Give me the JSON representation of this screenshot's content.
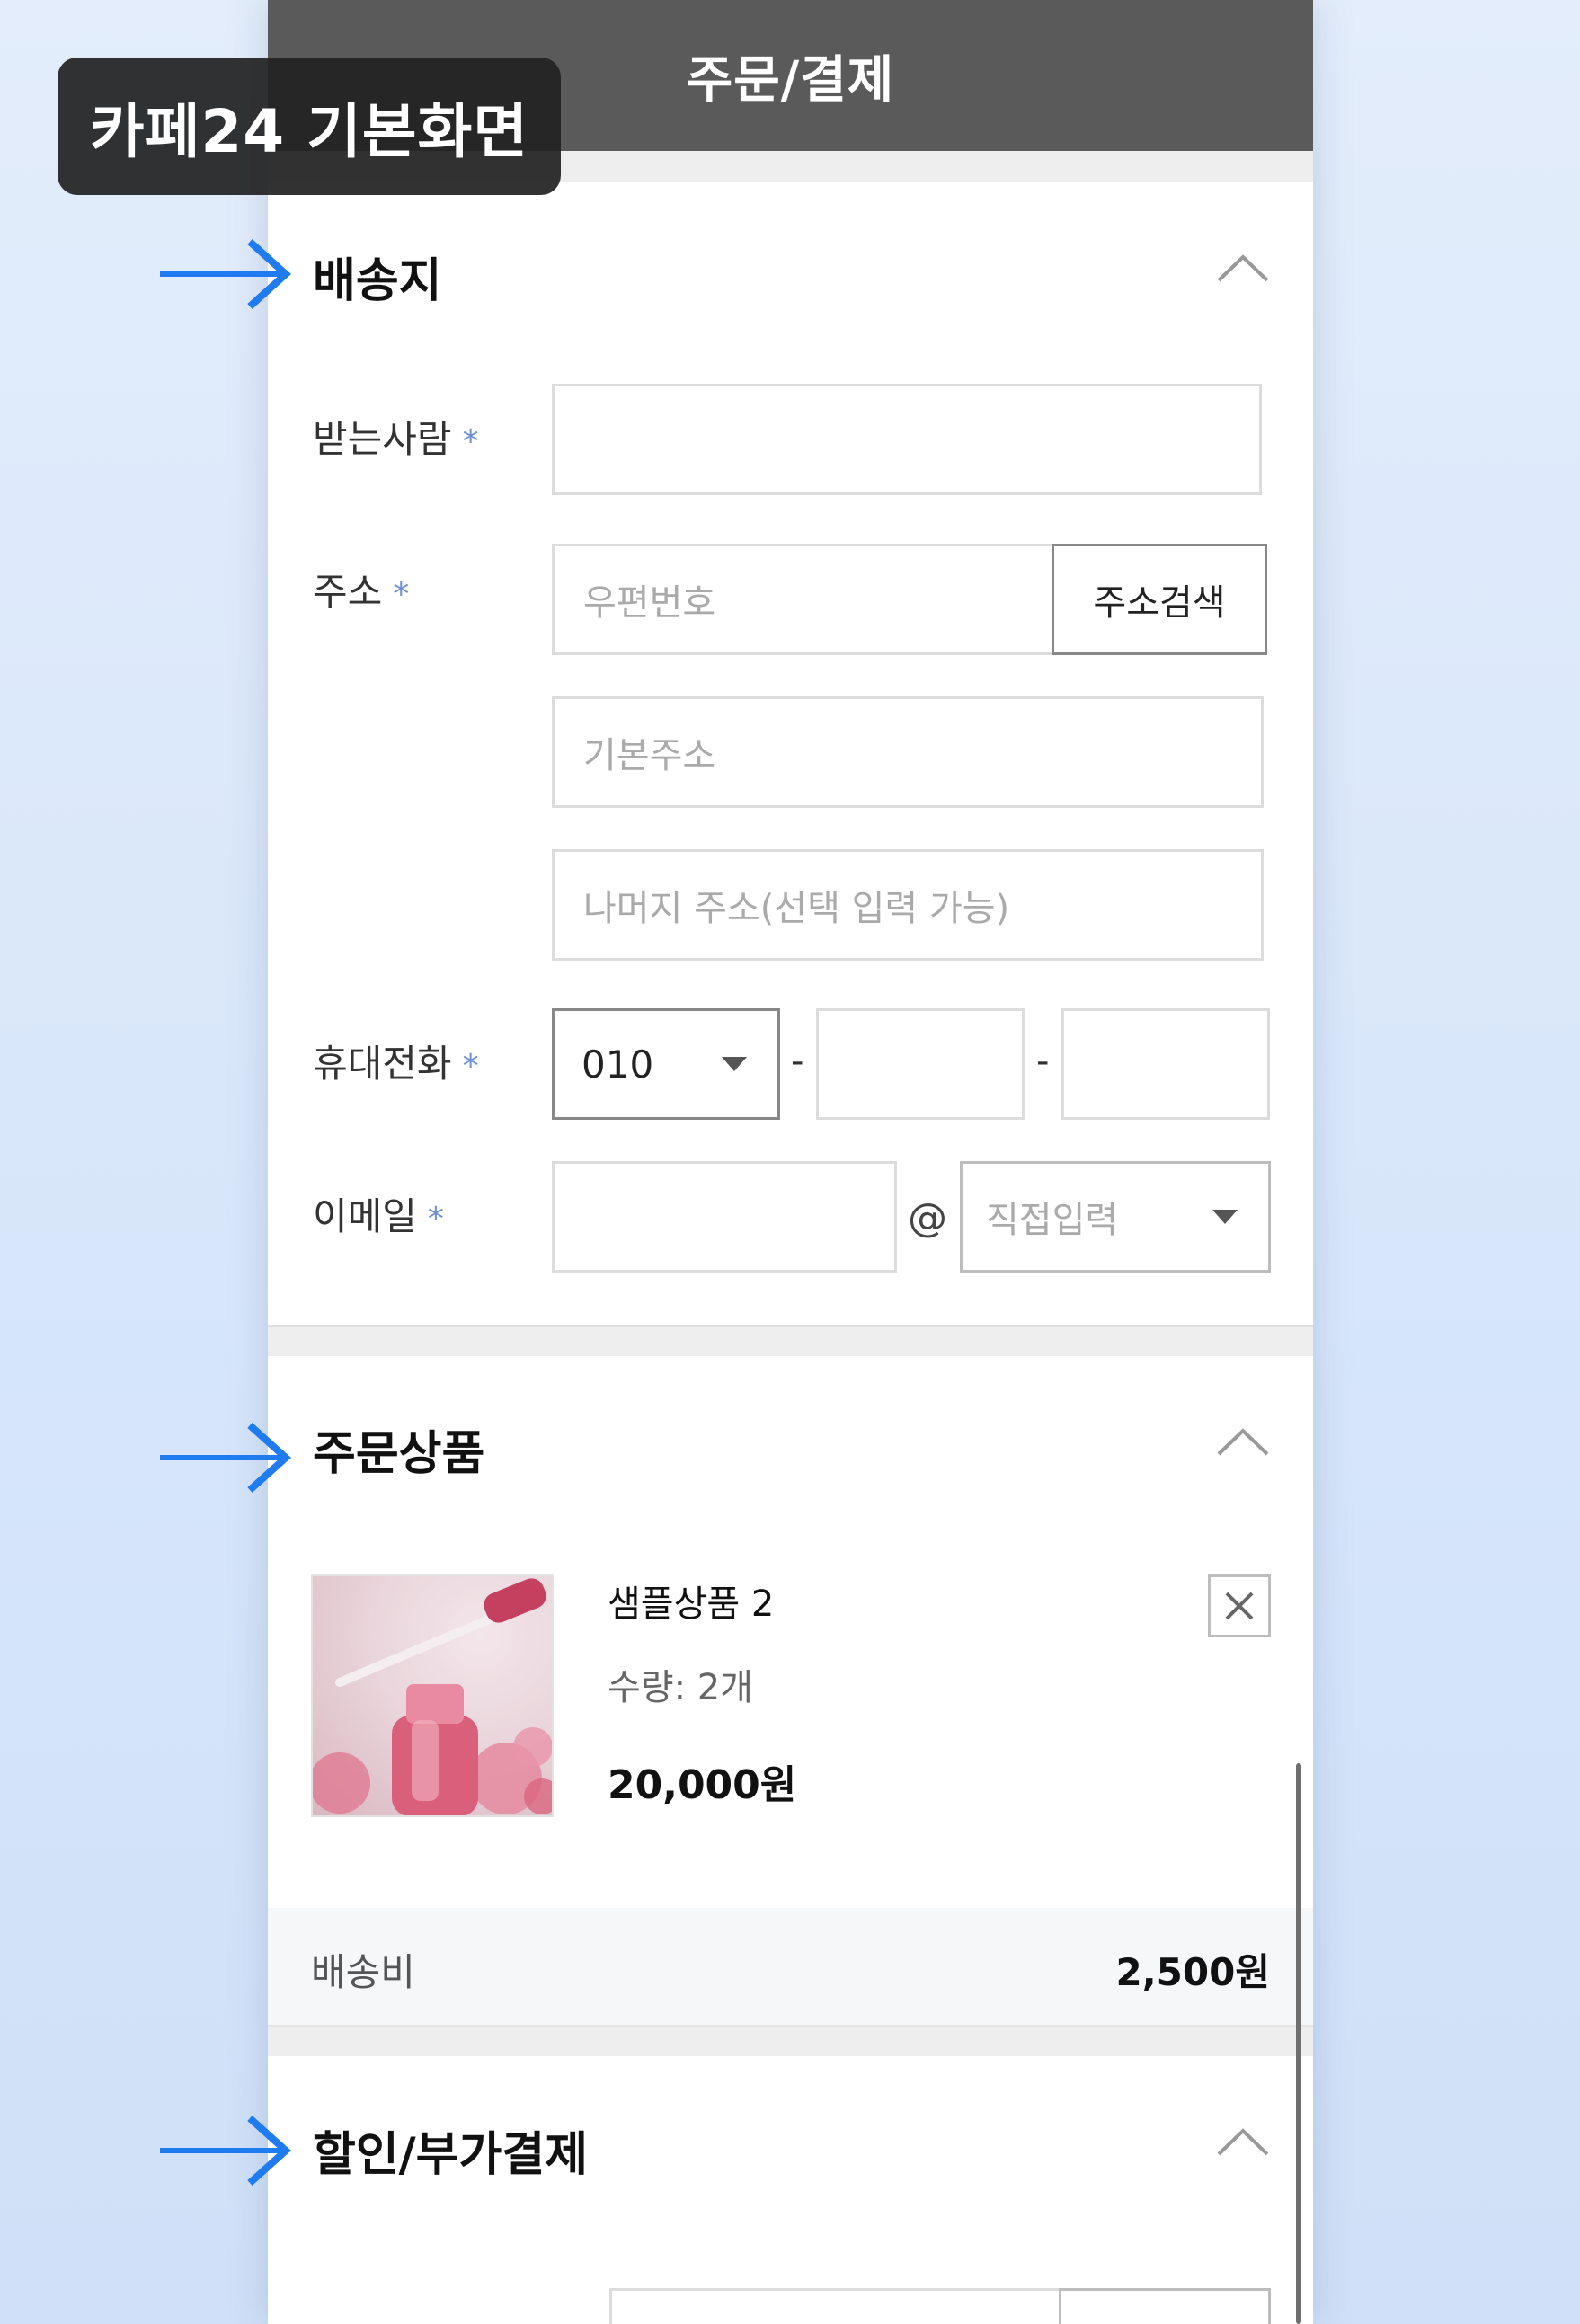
{
  "badge": {
    "text": "카페24 기본화면"
  },
  "header": {
    "title": "주문/결제"
  },
  "shipping": {
    "title": "배송지",
    "receiver_label": "받는사람",
    "address_label": "주소",
    "postcode_placeholder": "우편번호",
    "address_search_button": "주소검색",
    "base_address_placeholder": "기본주소",
    "detail_address_placeholder": "나머지 주소(선택 입력 가능)",
    "phone_label": "휴대전화",
    "phone_prefix": "010",
    "phone_separator": "-",
    "email_label": "이메일",
    "email_at": "@",
    "email_domain_placeholder": "직접입력",
    "required_mark": "*"
  },
  "order_items": {
    "title": "주문상품",
    "product": {
      "name": "샘플상품 2",
      "quantity": "수량: 2개",
      "price": "20,000원"
    },
    "shipping_fee_label": "배송비",
    "shipping_fee_value": "2,500원"
  },
  "discount": {
    "title": "할인/부가결제"
  },
  "colors": {
    "header_bg": "#5a5a5a",
    "accent_arrow": "#1f7cf0",
    "required_star": "#6c8fd8",
    "badge_bg": "#222222"
  },
  "icons": [
    "chevron-up-icon",
    "dropdown-caret-icon",
    "close-icon",
    "arrow-right-icon"
  ]
}
